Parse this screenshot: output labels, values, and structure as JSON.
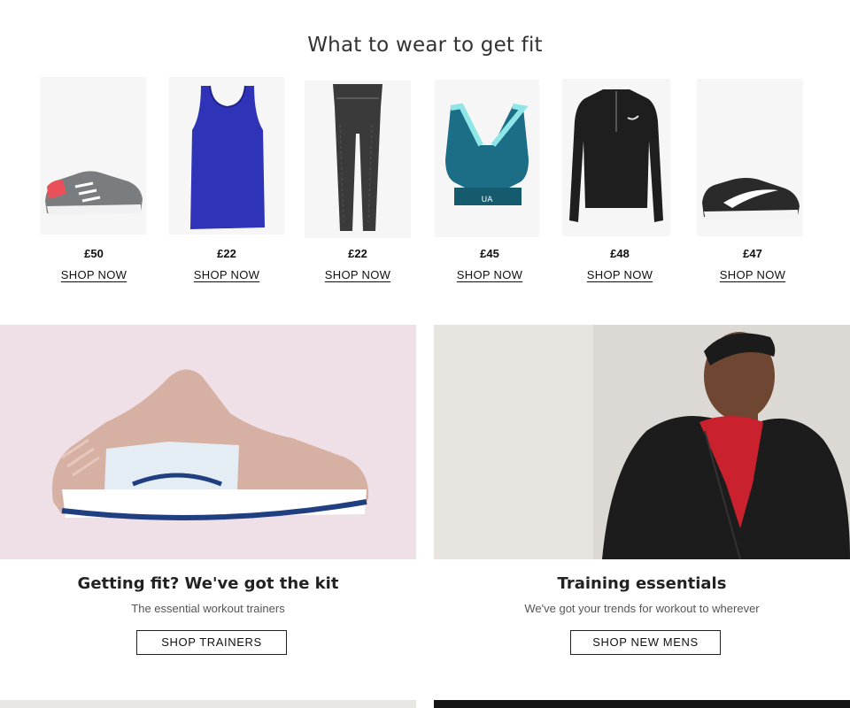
{
  "section": {
    "title": "What to wear to get fit"
  },
  "products": [
    {
      "price": "£50",
      "cta": "SHOP NOW",
      "image": "grey-running-trainer-image"
    },
    {
      "price": "£22",
      "cta": "SHOP NOW",
      "image": "blue-racerback-vest-image"
    },
    {
      "price": "£22",
      "cta": "SHOP NOW",
      "image": "grey-marl-leggings-image"
    },
    {
      "price": "£45",
      "cta": "SHOP NOW",
      "image": "teal-sports-bra-image"
    },
    {
      "price": "£48",
      "cta": "SHOP NOW",
      "image": "black-half-zip-top-image"
    },
    {
      "price": "£47",
      "cta": "SHOP NOW",
      "image": "black-white-trainer-image"
    }
  ],
  "promos": [
    {
      "heading": "Getting fit? We've got the kit",
      "subtext": "The essential workout trainers",
      "button": "SHOP TRAINERS",
      "image": "pink-boost-trainer-image"
    },
    {
      "heading": "Training essentials",
      "subtext": "We've got your trends for workout to wherever",
      "button": "SHOP NEW MENS",
      "image": "man-black-zip-hoodie-image"
    }
  ],
  "colors": {
    "text": "#222222",
    "thumb_bg": "#f6f6f6",
    "promo1_bg": "#efdfe6",
    "promo2_bg": "#e3e0dc"
  }
}
